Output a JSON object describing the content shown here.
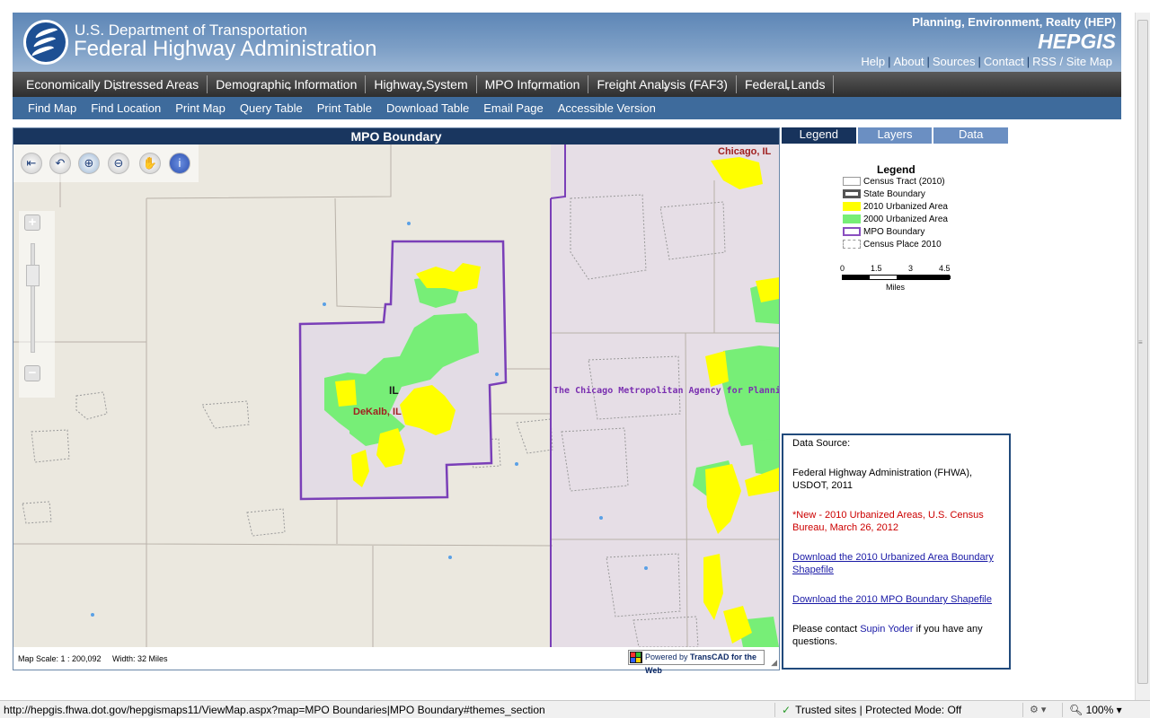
{
  "header": {
    "agency_line1": "U.S. Department of Transportation",
    "agency_line2": "Federal Highway Administration",
    "section_title": "Planning, Environment, Realty (HEP)",
    "app_title": "HEPGIS",
    "links": [
      "Help",
      "About",
      "Sources",
      "Contact",
      "RSS / Site Map"
    ]
  },
  "main_nav": [
    "Economically Distressed Areas",
    "Demographic Information",
    "Highway System",
    "MPO Information",
    "Freight Analysis (FAF3)",
    "Federal Lands"
  ],
  "sub_nav": [
    "Find Map",
    "Find Location",
    "Print Map",
    "Query Table",
    "Print Table",
    "Download Table",
    "Email Page",
    "Accessible Version"
  ],
  "map": {
    "title": "MPO Boundary",
    "labels": {
      "state": "IL",
      "city": "DeKalb, IL",
      "chicago": "Chicago, IL",
      "agency": "The Chicago Metropolitan Agency for Planning"
    },
    "tools": {
      "full_extent_icon": "full-extent-icon",
      "previous_extent_icon": "previous-extent-icon",
      "zoom_in_icon": "zoom-in-icon",
      "zoom_out_icon": "zoom-out-icon",
      "pan_icon": "pan-hand-icon",
      "info_icon": "info-icon"
    },
    "scale_text": "Map Scale: 1 : 200,092",
    "width_text": "Width: 32 Miles",
    "powered_prefix": "Powered by ",
    "powered_product": "TransCAD for the Web",
    "zoom_plus": "+",
    "zoom_minus": "−"
  },
  "tabs": [
    "Legend",
    "Layers",
    "Data"
  ],
  "active_tab": "Legend",
  "legend": {
    "title": "Legend",
    "items": [
      {
        "label": "Census Tract (2010)",
        "color": "#ffffff",
        "border": "#999999"
      },
      {
        "label": "State Boundary",
        "color": "#ffffff",
        "border": "#555555"
      },
      {
        "label": "2010 Urbanized Area",
        "color": "#ffff00",
        "border": "#ffff00"
      },
      {
        "label": "2000 Urbanized Area",
        "color": "#77ee77",
        "border": "#77ee77"
      },
      {
        "label": "MPO Boundary",
        "color": "#ffffff",
        "border": "#8a4fc0"
      },
      {
        "label": "Census Place 2010",
        "color": "#ffffff",
        "border": "#999999"
      }
    ],
    "scale_ticks": [
      "0",
      "1.5",
      "3",
      "4.5"
    ],
    "scale_units": "Miles"
  },
  "data_source": {
    "heading": "Data Source:",
    "source": "Federal Highway Administration (FHWA), USDOT, 2011",
    "new_note": "*New - 2010 Urbanized Areas, U.S. Census Bureau, March 26, 2012",
    "link1": "Download the 2010 Urbanized Area Boundary Shapefile",
    "link2": "Download the 2010 MPO Boundary Shapefile",
    "contact_prefix": "Please contact ",
    "contact_name": "Supin Yoder",
    "contact_suffix": " if you have any questions."
  },
  "status_bar": {
    "url": "http://hepgis.fhwa.dot.gov/hepgismaps11/ViewMap.aspx?map=MPO Boundaries|MPO Boundary#themes_section",
    "zone": "Trusted sites | Protected Mode: Off",
    "zoom": "100%"
  },
  "colors": {
    "header_blue": "#5d86b6",
    "nav_dark": "#2e2e2e",
    "subnav_blue": "#3e6b9c",
    "map_title_navy": "#19365f",
    "mpo_purple": "#7a3fb8",
    "urban_2010_yellow": "#ffff00",
    "urban_2000_green": "#77ee77"
  }
}
